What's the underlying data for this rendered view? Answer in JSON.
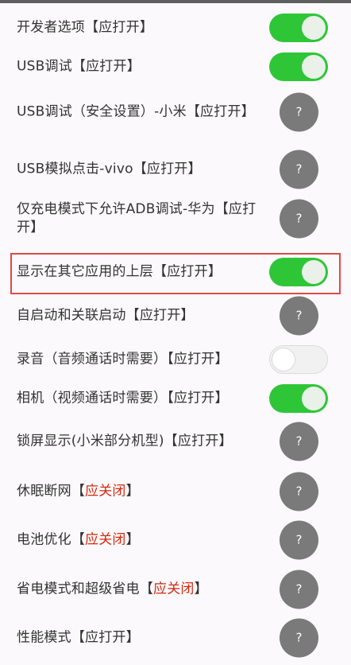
{
  "colors": {
    "toggle_on": "#2ec637",
    "help_button": "#7a7a7a",
    "status_red": "#d32a12",
    "highlight_border": "#e04848"
  },
  "help_glyph": "?",
  "items": [
    {
      "label": "开发者选项",
      "status": "应打开",
      "status_color": "normal",
      "control": "toggle",
      "toggle_on": true
    },
    {
      "label": "USB调试",
      "status": "应打开",
      "status_color": "normal",
      "control": "toggle",
      "toggle_on": true
    },
    {
      "label": "USB调试（安全设置）-小米",
      "status": "应打开",
      "status_color": "normal",
      "control": "help"
    },
    {
      "label": "USB模拟点击-vivo",
      "status": "应打开",
      "status_color": "normal",
      "control": "help"
    },
    {
      "label": "仅充电模式下允许ADB调试-华为",
      "status": "应打开",
      "status_color": "normal",
      "control": "help"
    },
    {
      "label": "显示在其它应用的上层",
      "status": "应打开",
      "status_color": "normal",
      "control": "toggle",
      "toggle_on": true,
      "highlighted": true
    },
    {
      "label": "自启动和关联启动",
      "status": "应打开",
      "status_color": "normal",
      "control": "help"
    },
    {
      "label": "录音（音频通话时需要）",
      "status": "应打开",
      "status_color": "normal",
      "control": "toggle",
      "toggle_on": false
    },
    {
      "label": "相机（视频通话时需要）",
      "status": "应打开",
      "status_color": "normal",
      "control": "toggle",
      "toggle_on": true
    },
    {
      "label": "锁屏显示(小米部分机型)",
      "status": "应打开",
      "status_color": "normal",
      "control": "help"
    },
    {
      "label": "休眠断网",
      "status": "应关闭",
      "status_color": "red",
      "control": "help"
    },
    {
      "label": "电池优化",
      "status": "应关闭",
      "status_color": "red",
      "control": "help"
    },
    {
      "label": "省电模式和超级省电",
      "status": "应关闭",
      "status_color": "red",
      "control": "help"
    },
    {
      "label": "性能模式",
      "status": "应打开",
      "status_color": "normal",
      "control": "help"
    }
  ]
}
